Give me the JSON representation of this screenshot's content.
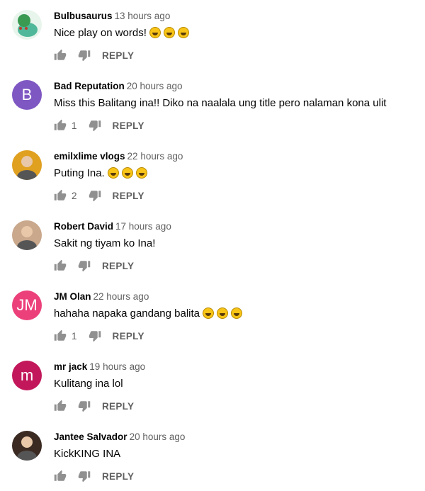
{
  "comments": [
    {
      "author": "Bulbusaurus",
      "time": "13 hours ago",
      "text": "Nice play on words!",
      "emoji_count": 3,
      "emoji": "rofl-emoji",
      "likes": "",
      "reply_label": "REPLY",
      "avatar": {
        "type": "image",
        "icon": "bulbasaur-avatar",
        "color": "#1aa36b"
      }
    },
    {
      "author": "Bad Reputation",
      "time": "20 hours ago",
      "text": "Miss this Balitang ina!! Diko na naalala ung title pero nalaman kona ulit",
      "emoji_count": 0,
      "likes": "1",
      "reply_label": "REPLY",
      "avatar": {
        "type": "letter",
        "letter": "B",
        "color": "#7e57c2"
      }
    },
    {
      "author": "emilxlime vlogs",
      "time": "22 hours ago",
      "text": "Puting Ina.",
      "emoji_count": 3,
      "emoji": "rofl-emoji",
      "likes": "2",
      "reply_label": "REPLY",
      "avatar": {
        "type": "image",
        "icon": "person-avatar",
        "color": "#e0a020"
      }
    },
    {
      "author": "Robert David",
      "time": "17 hours ago",
      "text": "Sakit ng tiyam ko Ina!",
      "emoji_count": 0,
      "likes": "",
      "reply_label": "REPLY",
      "avatar": {
        "type": "image",
        "icon": "person-avatar",
        "color": "#c9a88c"
      }
    },
    {
      "author": "JM Olan",
      "time": "22 hours ago",
      "text": "hahaha napaka gandang balita",
      "emoji_count": 3,
      "emoji": "grin-emoji",
      "likes": "1",
      "reply_label": "REPLY",
      "avatar": {
        "type": "letter",
        "letter": "JM",
        "color": "#ec407a"
      }
    },
    {
      "author": "mr jack",
      "time": "19 hours ago",
      "text": "Kulitang ina lol",
      "emoji_count": 0,
      "likes": "",
      "reply_label": "REPLY",
      "avatar": {
        "type": "letter",
        "letter": "m",
        "color": "#c2185b"
      }
    },
    {
      "author": "Jantee Salvador",
      "time": "20 hours ago",
      "text": "KickKING INA",
      "emoji_count": 0,
      "likes": "",
      "reply_label": "REPLY",
      "avatar": {
        "type": "image",
        "icon": "person-avatar",
        "color": "#3b2a22"
      }
    }
  ]
}
